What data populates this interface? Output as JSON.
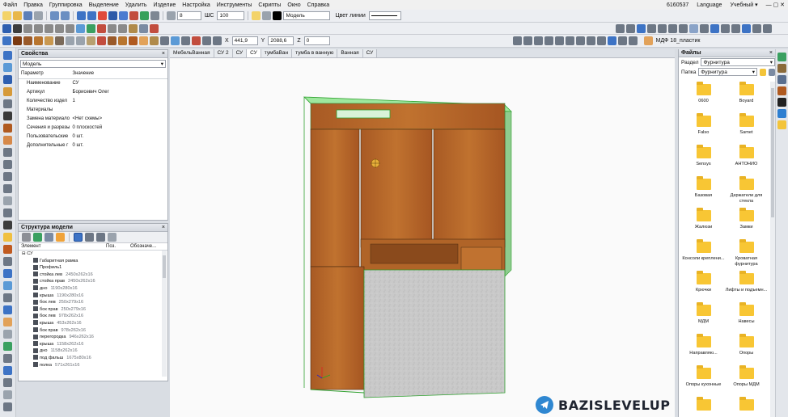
{
  "menu": [
    "Файл",
    "Правка",
    "Группировка",
    "Выделение",
    "Удалить",
    "Изделие",
    "Настройка",
    "Инструменты",
    "Скрипты",
    "Окно",
    "Справка"
  ],
  "menu_right": {
    "code": "6160537",
    "language": "Language",
    "mode": "Учебный ▾"
  },
  "toolbar1": {
    "line_width": "8",
    "step_label": "ШС",
    "step_value": "100",
    "layer": "Модель",
    "line_color_label": "Цвет линии"
  },
  "toolbar3": {
    "x_label": "X",
    "x_value": "441,9",
    "y_label": "Y",
    "y_value": "2088,6",
    "z_label": "Z",
    "z_value": "0",
    "material": "МДФ 18_пластик"
  },
  "properties": {
    "title": "Свойства",
    "close": "×",
    "selector": "Модель",
    "col_param": "Параметр",
    "col_value": "Значение",
    "rows": [
      {
        "k": "Наименование",
        "v": "СУ"
      },
      {
        "k": "Артикул",
        "v": "Борисевич Олег"
      },
      {
        "k": "Количество издел",
        "v": "1"
      },
      {
        "k": "Материалы",
        "v": ""
      },
      {
        "k": "Замена материало",
        "v": "<Нет схемы>"
      },
      {
        "k": "Сечения и разрезы",
        "v": "0 плоскостей"
      },
      {
        "k": "Пользовательские",
        "v": "0 шт."
      },
      {
        "k": "Дополнительные г",
        "v": "0 шт."
      }
    ]
  },
  "structure": {
    "title": "Структура модели",
    "close": "×",
    "col_element": "Элемент",
    "col_pos": "Поз.",
    "col_desc": "Обозначе...",
    "root": "СУ",
    "items": [
      {
        "name": "Габаритная рамка",
        "dim": ""
      },
      {
        "name": "Профиль1",
        "dim": ""
      },
      {
        "name": "стойка лев",
        "dim": "2450x262x16"
      },
      {
        "name": "стойка прав",
        "dim": "2450x262x16"
      },
      {
        "name": "дно",
        "dim": "1190x280x16"
      },
      {
        "name": "крыша",
        "dim": "1190x280x16"
      },
      {
        "name": "бок лев",
        "dim": "250x279x16"
      },
      {
        "name": "бок прав",
        "dim": "250x279x16"
      },
      {
        "name": "бок лев",
        "dim": "978x262x16"
      },
      {
        "name": "крыша",
        "dim": "453x262x16"
      },
      {
        "name": "бок прав",
        "dim": "978x262x16"
      },
      {
        "name": "перегородка",
        "dim": "946x262x16"
      },
      {
        "name": "крыша",
        "dim": "1158x262x16"
      },
      {
        "name": "дно",
        "dim": "1158x262x16"
      },
      {
        "name": "под фальш",
        "dim": "1675x80x16"
      },
      {
        "name": "полка",
        "dim": "571x261x16"
      }
    ]
  },
  "tabs": [
    {
      "label": "МебельВанная",
      "active": false
    },
    {
      "label": "СУ 2",
      "active": false
    },
    {
      "label": "СУ",
      "active": false
    },
    {
      "label": "СУ",
      "active": true
    },
    {
      "label": "тумбаВан",
      "active": false
    },
    {
      "label": "тумба в ванную",
      "active": false
    },
    {
      "label": "Ванная",
      "active": false
    },
    {
      "label": "СУ",
      "active": false
    }
  ],
  "files": {
    "title": "Файлы",
    "close": "×",
    "section_label": "Раздел",
    "section_value": "Фурнитура",
    "folder_label": "Папка",
    "folder_value": "Фурнитура",
    "folders": [
      "0600",
      "Boyard",
      "Falso",
      "Samet",
      "Sensys",
      "АНТОНИО",
      "Базовая",
      "Держатели для стекла",
      "Жалюзи",
      "Замки",
      "Консоли креплени...",
      "Кроватная фурнитура",
      "Крючки",
      "Лифты и подъемн...",
      "МДМ",
      "Навесы",
      "Направляю...",
      "Опоры",
      "Опоры кухонные",
      "Опоры МДМ",
      "",
      ""
    ]
  },
  "brand": "BAZISLEVELUP",
  "colors": {
    "wood": "#b5652a",
    "frame_highlight": "#7cd67c",
    "stone": "#c8c8c8",
    "accent": "#2f87d1"
  }
}
